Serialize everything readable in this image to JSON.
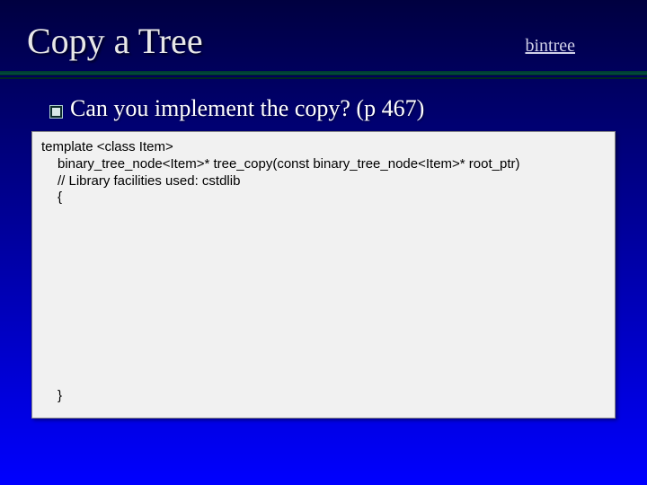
{
  "title": "Copy a Tree",
  "link_label": "bintree",
  "bullet_text": "Can you implement the copy?  (p 467)",
  "code": {
    "line1": "template <class Item>",
    "line2": "binary_tree_node<Item>* tree_copy(const binary_tree_node<Item>* root_ptr)",
    "line3": "// Library facilities used: cstdlib",
    "line4": "{",
    "close": "}"
  }
}
